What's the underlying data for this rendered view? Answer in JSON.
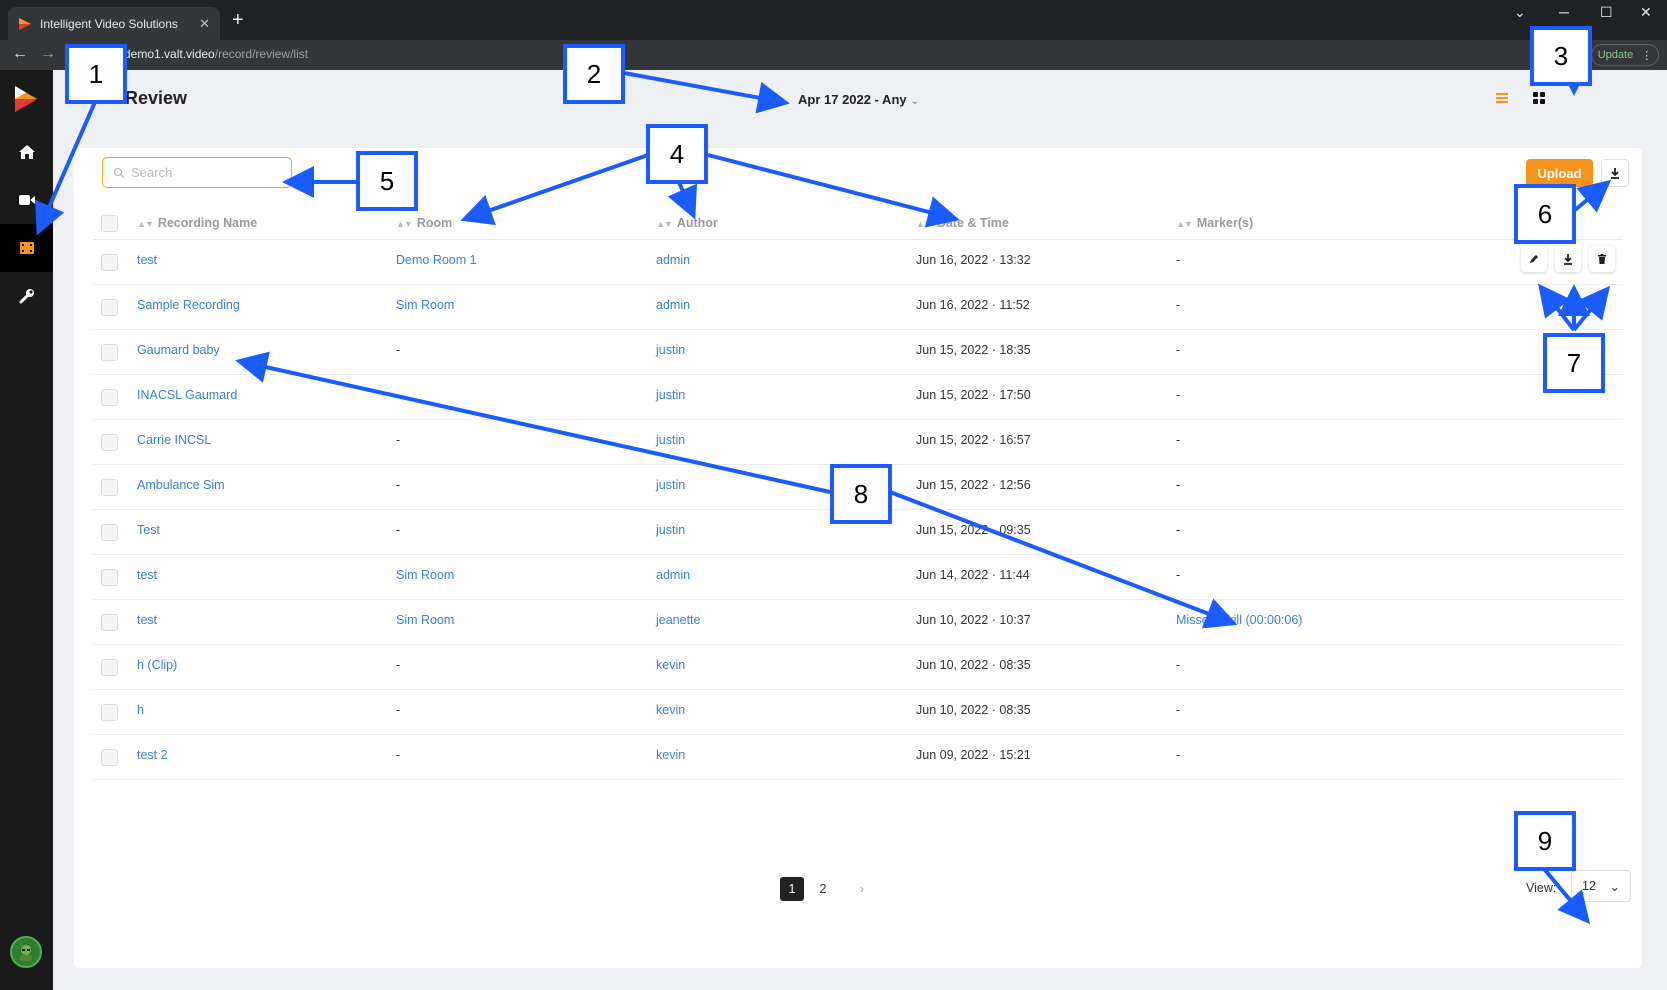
{
  "browser": {
    "tab_title": "Intelligent Video Solutions",
    "tab_close": "✕",
    "new_tab": "+",
    "url_host": "demo1.valt.video",
    "url_path": "/record/review/list",
    "update_label": "Update"
  },
  "sidebar": {
    "items": [
      "home-icon",
      "camera-icon",
      "film-icon",
      "wrench-icon"
    ]
  },
  "header": {
    "title": "Review",
    "date_filter": "Apr 17 2022 - Any"
  },
  "toolbar": {
    "search_placeholder": "Search",
    "upload_label": "Upload"
  },
  "table": {
    "columns": [
      "Recording Name",
      "Room",
      "Author",
      "Date & Time",
      "Marker(s)"
    ],
    "rows": [
      {
        "name": "test",
        "room": "Demo Room 1",
        "author": "admin",
        "datetime": "Jun 16, 2022 · 13:32",
        "markers": "-"
      },
      {
        "name": "Sample Recording",
        "room": "Sim Room",
        "author": "admin",
        "datetime": "Jun 16, 2022 · 11:52",
        "markers": "-"
      },
      {
        "name": "Gaumard baby",
        "room": "-",
        "author": "justin",
        "datetime": "Jun 15, 2022 · 18:35",
        "markers": "-"
      },
      {
        "name": "INACSL Gaumard",
        "room": "-",
        "author": "justin",
        "datetime": "Jun 15, 2022 · 17:50",
        "markers": "-"
      },
      {
        "name": "Carrie INCSL",
        "room": "-",
        "author": "justin",
        "datetime": "Jun 15, 2022 · 16:57",
        "markers": "-"
      },
      {
        "name": "Ambulance Sim",
        "room": "-",
        "author": "justin",
        "datetime": "Jun 15, 2022 · 12:56",
        "markers": "-"
      },
      {
        "name": "Test",
        "room": "-",
        "author": "justin",
        "datetime": "Jun 15, 2022 · 09:35",
        "markers": "-"
      },
      {
        "name": "test",
        "room": "Sim Room",
        "author": "admin",
        "datetime": "Jun 14, 2022 · 11:44",
        "markers": "-"
      },
      {
        "name": "test",
        "room": "Sim Room",
        "author": "jeanette",
        "datetime": "Jun 10, 2022 · 10:37",
        "markers": "Missed Skill (00:00:06)"
      },
      {
        "name": "h (Clip)",
        "room": "-",
        "author": "kevin",
        "datetime": "Jun 10, 2022 · 08:35",
        "markers": "-"
      },
      {
        "name": "h",
        "room": "-",
        "author": "kevin",
        "datetime": "Jun 10, 2022 · 08:35",
        "markers": "-"
      },
      {
        "name": "test 2",
        "room": "-",
        "author": "kevin",
        "datetime": "Jun 09, 2022 · 15:21",
        "markers": "-"
      }
    ]
  },
  "pagination": {
    "pages": [
      "1",
      "2"
    ],
    "next": "›",
    "view_label": "View:",
    "per_page": "12"
  },
  "callouts": [
    "1",
    "2",
    "3",
    "4",
    "5",
    "6",
    "7",
    "8",
    "9"
  ],
  "colors": {
    "accent": "#f7941d",
    "link": "#3a7fd5",
    "callout_border": "#1a5cff"
  }
}
